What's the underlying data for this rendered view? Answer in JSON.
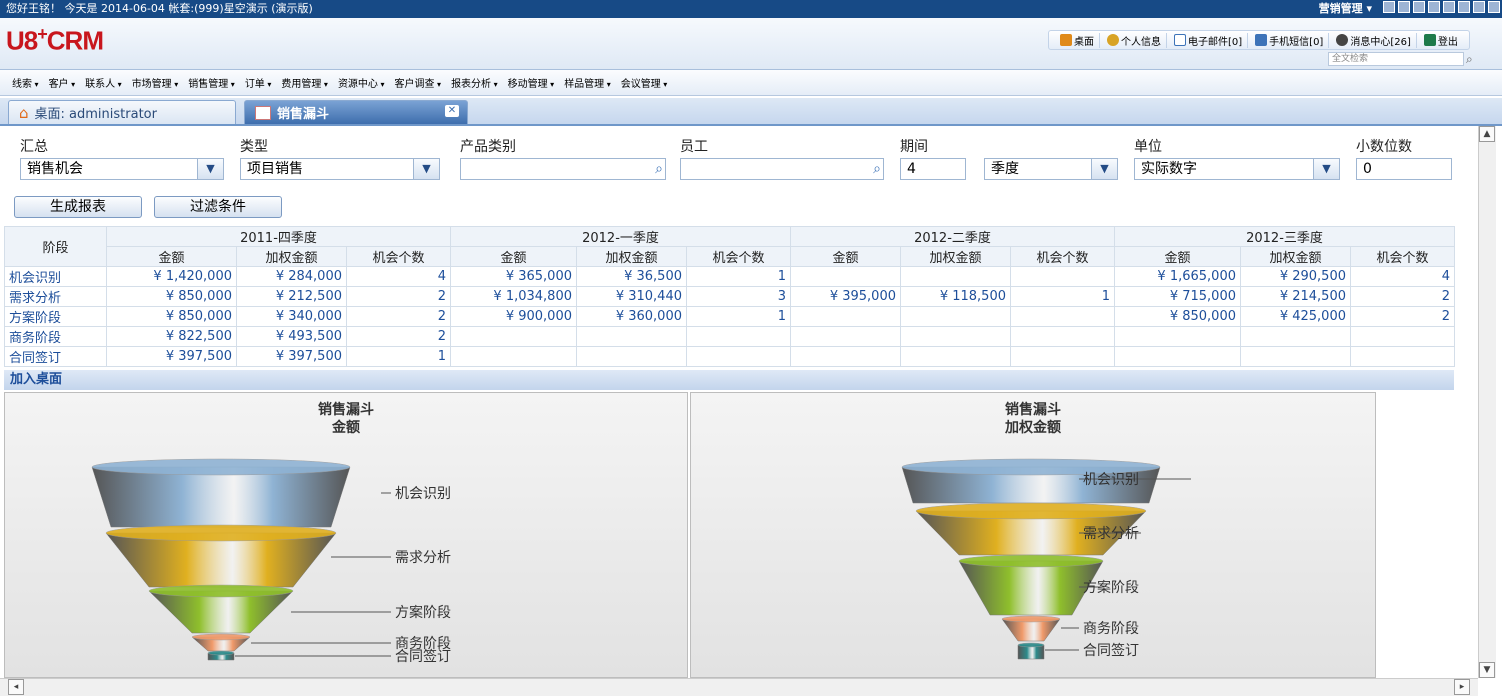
{
  "topbar": {
    "greeting": "您好王铭！ 今天是 2014-06-04 帐套:(999)星空演示 (演示版)",
    "module": "营销管理 ▾"
  },
  "logo": {
    "brand": "U8",
    "sup": "+",
    "product": "CRM"
  },
  "quicklinks": [
    {
      "label": "桌面"
    },
    {
      "label": "个人信息"
    },
    {
      "label": "电子邮件[0]"
    },
    {
      "label": "手机短信[0]"
    },
    {
      "label": "消息中心[26]"
    },
    {
      "label": "登出"
    }
  ],
  "search": {
    "placeholder": "全文检索"
  },
  "menu": [
    "线索",
    "客户",
    "联系人",
    "市场管理",
    "销售管理",
    "订单",
    "费用管理",
    "资源中心",
    "客户调查",
    "报表分析",
    "移动管理",
    "样品管理",
    "会议管理"
  ],
  "tabs": {
    "desktop": "桌面: administrator",
    "report": "销售漏斗",
    "close": "✕"
  },
  "filters": {
    "summary": {
      "label": "汇总",
      "value": "销售机会"
    },
    "type": {
      "label": "类型",
      "value": "项目销售"
    },
    "product": {
      "label": "产品类别",
      "value": ""
    },
    "staff": {
      "label": "员工",
      "value": ""
    },
    "period": {
      "label": "期间",
      "value": "4",
      "unit": "季度"
    },
    "unit": {
      "label": "单位",
      "value": "实际数字"
    },
    "decimals": {
      "label": "小数位数",
      "value": "0"
    }
  },
  "buttons": {
    "generate": "生成报表",
    "filter": "过滤条件"
  },
  "table": {
    "stage_header": "阶段",
    "periods": [
      "2011-四季度",
      "2012-一季度",
      "2012-二季度",
      "2012-三季度"
    ],
    "subcols": [
      "金额",
      "加权金额",
      "机会个数"
    ],
    "rows": [
      {
        "stage": "机会识别",
        "cells": [
          "¥ 1,420,000",
          "¥ 284,000",
          "4",
          "¥ 365,000",
          "¥ 36,500",
          "1",
          "",
          "",
          "",
          "¥ 1,665,000",
          "¥ 290,500",
          "4"
        ]
      },
      {
        "stage": "需求分析",
        "cells": [
          "¥ 850,000",
          "¥ 212,500",
          "2",
          "¥ 1,034,800",
          "¥ 310,440",
          "3",
          "¥ 395,000",
          "¥ 118,500",
          "1",
          "¥ 715,000",
          "¥ 214,500",
          "2"
        ]
      },
      {
        "stage": "方案阶段",
        "cells": [
          "¥ 850,000",
          "¥ 340,000",
          "2",
          "¥ 900,000",
          "¥ 360,000",
          "1",
          "",
          "",
          "",
          "¥ 850,000",
          "¥ 425,000",
          "2"
        ]
      },
      {
        "stage": "商务阶段",
        "cells": [
          "¥ 822,500",
          "¥ 493,500",
          "2",
          "",
          "",
          "",
          "",
          "",
          "",
          "",
          "",
          ""
        ]
      },
      {
        "stage": "合同签订",
        "cells": [
          "¥ 397,500",
          "¥ 397,500",
          "1",
          "",
          "",
          "",
          "",
          "",
          "",
          "",
          "",
          ""
        ]
      }
    ]
  },
  "add_desktop": "加入桌面",
  "chart_data": [
    {
      "type": "funnel",
      "title": "销售漏斗",
      "subtitle": "金额",
      "categories": [
        "机会识别",
        "需求分析",
        "方案阶段",
        "商务阶段",
        "合同签订"
      ],
      "colors": [
        "#8fb3d4",
        "#e0b020",
        "#8fbf2c",
        "#f09a6a",
        "#2c8c8c"
      ]
    },
    {
      "type": "funnel",
      "title": "销售漏斗",
      "subtitle": "加权金额",
      "categories": [
        "机会识别",
        "需求分析",
        "方案阶段",
        "商务阶段",
        "合同签订"
      ],
      "colors": [
        "#8fb3d4",
        "#e0b020",
        "#8fbf2c",
        "#f09a6a",
        "#2c8c8c"
      ]
    }
  ]
}
